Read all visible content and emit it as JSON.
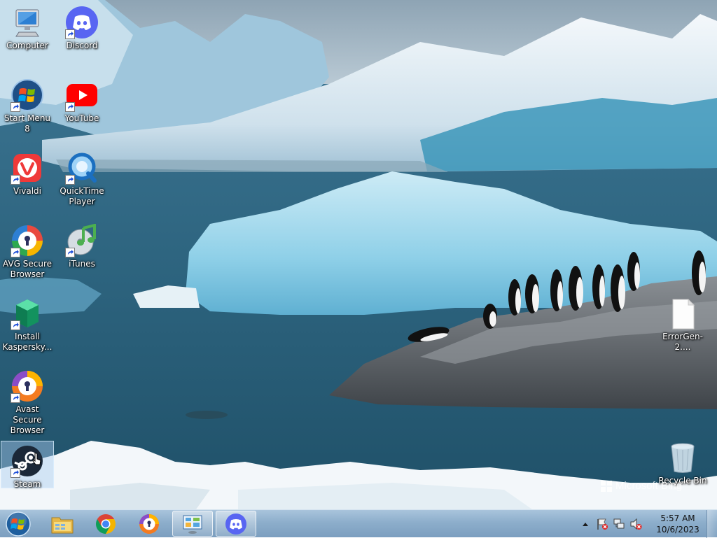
{
  "desktop": {
    "icons": [
      {
        "label": "Computer"
      },
      {
        "label": "Discord"
      },
      {
        "label": "Start Menu 8"
      },
      {
        "label": "YouTube"
      },
      {
        "label": "Vivaldi"
      },
      {
        "label": "QuickTime Player"
      },
      {
        "label": "AVG Secure Browser"
      },
      {
        "label": "iTunes"
      },
      {
        "label": "Install Kaspersky..."
      },
      {
        "label": "Avast Secure Browser"
      },
      {
        "label": "Steam"
      },
      {
        "label": "ErrorGen-2...."
      },
      {
        "label": "Recycle Bin"
      }
    ],
    "selected_icon": "Steam"
  },
  "watermark": {
    "text": "Microsoft Bing"
  },
  "taskbar": {
    "pinned": [
      "windows-explorer-icon",
      "chrome-icon",
      "avast-browser-icon",
      "control-panel-icon",
      "discord-icon"
    ],
    "active": [
      "control-panel",
      "discord"
    ],
    "tray_icons": [
      "show-hidden-icons-arrow",
      "action-center-flag-icon",
      "network-icon",
      "volume-muted-icon"
    ],
    "clock": {
      "time": "5:57 AM",
      "date": "10/6/2023"
    }
  },
  "colors": {
    "taskbar": "#8daecb",
    "discord": "#5865f2",
    "youtube": "#ff0000",
    "vivaldi": "#ef3939",
    "steam": "#1b2838"
  }
}
